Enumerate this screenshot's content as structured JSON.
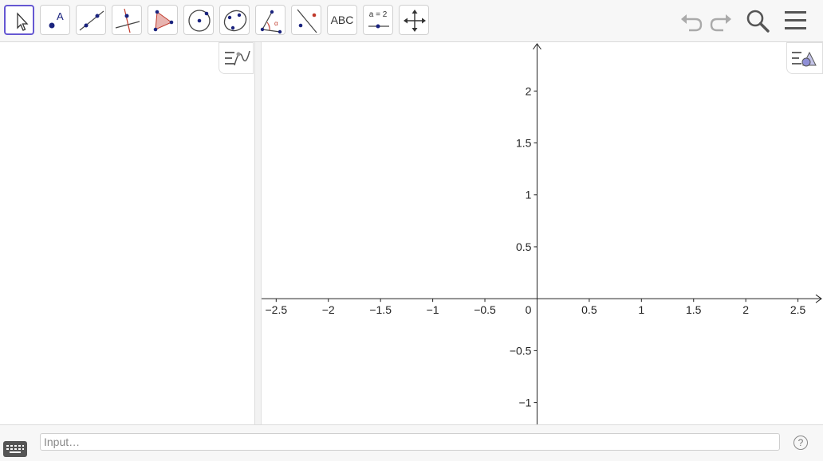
{
  "toolbar": {
    "tools": [
      {
        "name": "move-tool",
        "icon": "cursor-arrow-icon",
        "selected": true
      },
      {
        "name": "point-tool",
        "icon": "point-icon"
      },
      {
        "name": "line-tool",
        "icon": "line-through-two-points-icon"
      },
      {
        "name": "perpendicular-line-tool",
        "icon": "perpendicular-line-icon"
      },
      {
        "name": "polygon-tool",
        "icon": "polygon-icon"
      },
      {
        "name": "circle-tool",
        "icon": "circle-center-point-icon"
      },
      {
        "name": "conic-tool",
        "icon": "ellipse-icon"
      },
      {
        "name": "angle-tool",
        "icon": "angle-icon"
      },
      {
        "name": "reflect-tool",
        "icon": "reflect-about-line-icon"
      },
      {
        "name": "text-tool",
        "icon": "text-icon",
        "label": "ABC"
      },
      {
        "name": "slider-tool",
        "icon": "slider-icon",
        "label": "a = 2"
      },
      {
        "name": "move-graphics-view-tool",
        "icon": "move-arrows-icon"
      }
    ],
    "right_buttons": [
      "undo-icon",
      "redo-icon",
      "search-icon",
      "menu-icon"
    ]
  },
  "algebra_view": {
    "style_bar_icon": "algebra-style-bar-icon"
  },
  "graphics_view": {
    "style_bar_icon": "graphics-style-bar-icon",
    "x_ticks": [
      "−2.5",
      "−2",
      "−1.5",
      "−1",
      "−0.5",
      "0.5",
      "1",
      "1.5",
      "2",
      "2.5"
    ],
    "y_ticks": [
      "2",
      "1.5",
      "1",
      "0.5",
      "−0.5",
      "−1"
    ],
    "origin_label": "0",
    "x_values": [
      -2.5,
      -2,
      -1.5,
      -1,
      -0.5,
      0.5,
      1,
      1.5,
      2,
      2.5
    ],
    "y_values": [
      2,
      1.5,
      1,
      0.5,
      -0.5,
      -1
    ],
    "x_range": [
      -2.64,
      2.74
    ],
    "y_range": [
      -1.21,
      2.47
    ]
  },
  "input_bar": {
    "placeholder": "Input…",
    "help_label": "?",
    "keyboard_icon": "keyboard-icon"
  },
  "colors": {
    "accent": "#6557d2",
    "point": "#1a237e",
    "red": "#c0392b"
  }
}
